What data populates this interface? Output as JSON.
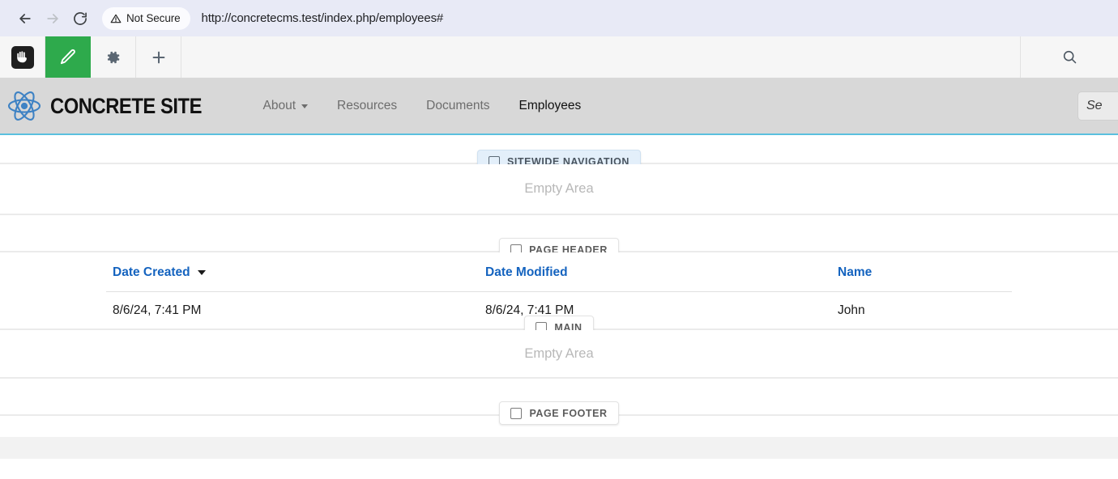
{
  "browser": {
    "back_icon": "arrow-left-icon",
    "forward_icon": "arrow-right-icon",
    "reload_icon": "reload-icon",
    "security_label": "Not Secure",
    "security_icon": "warning-triangle-icon",
    "url": "http://concretecms.test/index.php/employees#"
  },
  "cms_toolbar": {
    "logo_icon": "concrete-hand-icon",
    "edit_icon": "pencil-icon",
    "settings_icon": "gear-icon",
    "add_icon": "plus-icon",
    "search_icon": "magnifier-icon",
    "edit_accent_color": "#2eaa4c"
  },
  "site_header": {
    "brand_name": "CONCRETE SITE",
    "logo_icon": "atom-logo-icon",
    "logo_color": "#3e82c4",
    "background_color": "#d8d8d8",
    "accent_underline_color": "#5bc0de",
    "nav": [
      {
        "label": "About",
        "has_dropdown": true,
        "active": false
      },
      {
        "label": "Resources",
        "has_dropdown": false,
        "active": false
      },
      {
        "label": "Documents",
        "has_dropdown": false,
        "active": false
      },
      {
        "label": "Employees",
        "has_dropdown": false,
        "active": true
      }
    ],
    "drag_handle_icon": "move-arrows-icon",
    "search_placeholder": "Se"
  },
  "areas": [
    {
      "tag": "Sitewide Navigation",
      "tag_icon": "square-outline-icon",
      "highlighted": true,
      "empty_label": null
    },
    {
      "tag": null,
      "tag_icon": null,
      "highlighted": false,
      "empty_label": "Empty Area"
    },
    {
      "tag": "Page Header",
      "tag_icon": "square-outline-icon",
      "highlighted": false,
      "empty_label": null
    },
    {
      "tag": "Main",
      "tag_icon": "square-outline-icon",
      "highlighted": false,
      "empty_label": null
    },
    {
      "tag": null,
      "tag_icon": null,
      "highlighted": false,
      "empty_label": "Empty Area"
    },
    {
      "tag": "Page Footer",
      "tag_icon": "square-outline-icon",
      "highlighted": false,
      "empty_label": null
    }
  ],
  "employees_table": {
    "columns": [
      {
        "label": "Date Created",
        "sorted": true,
        "sort_direction": "desc"
      },
      {
        "label": "Date Modified",
        "sorted": false,
        "sort_direction": null
      },
      {
        "label": "Name",
        "sorted": false,
        "sort_direction": null
      }
    ],
    "rows": [
      {
        "date_created": "8/6/24, 7:41 PM",
        "date_modified": "8/6/24, 7:41 PM",
        "name": "John"
      }
    ],
    "header_link_color": "#1463bf"
  }
}
